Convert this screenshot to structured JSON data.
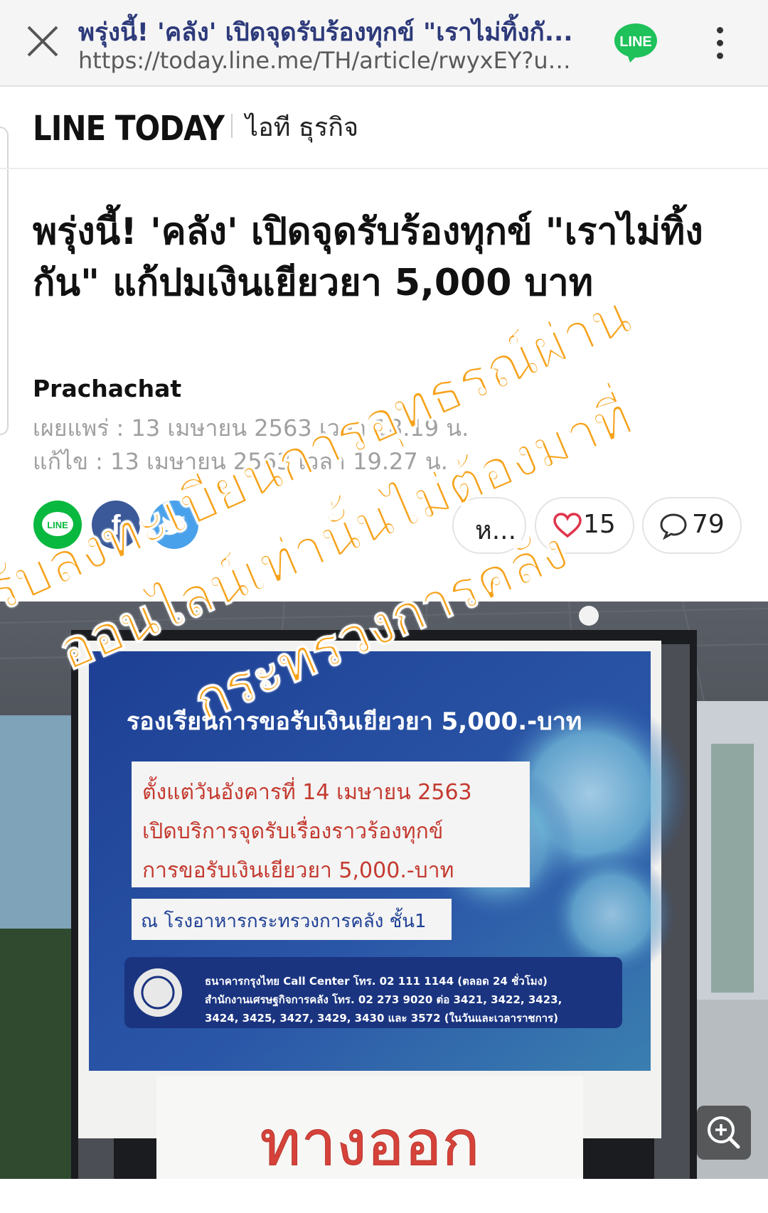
{
  "browser": {
    "page_title": "พรุ่งนี้! 'คลัง' เปิดจุดรับร้องทุกข์ \"เราไม่ทิ้งกั...",
    "url": "https://today.line.me/TH/article/rwyxEY?ut...",
    "close_icon": "close-icon",
    "app_badge": "LINE",
    "menu_icon": "more-vert-icon"
  },
  "header": {
    "brand": "LINE TODAY",
    "section": "ไอที ธุรกิจ"
  },
  "article": {
    "headline": "พรุ่งนี้! 'คลัง' เปิดจุดรับร้องทุกข์ \"เราไม่ทิ้งกัน\" แก้ปมเงินเยียวยา 5,000 บาท",
    "source": "Prachachat",
    "published": "เผยแพร่ : 13 เมษายน 2563 เวลา 18.19 น.",
    "edited": "แก้ไข : 13 เมษายน 2563 เวลา 19.27 น."
  },
  "actions": {
    "share_line": "LINE",
    "share_facebook": "f",
    "share_twitter": "twitter-icon",
    "pill_partial": "ห...",
    "likes": "15",
    "comments": "79",
    "like_color": "#e0344a"
  },
  "overlay": {
    "line1": "รับลงทะเบียนการอุทธรณ์ผ่าน",
    "line2": "ออนไลน์เท่านั้นไม่ต้องมาที่",
    "line3": "กระทรวงการคลัง",
    "color": "#f6a21a"
  },
  "photo": {
    "title": "รองเรียนการขอรับเงินเยียวยา 5,000.-บาท",
    "box_line1": "ตั้งแต่วันอังคารที่ 14 เมษายน 2563",
    "box_line2": "เปิดบริการจุดรับเรื่องราวร้องทุกข์",
    "box_line3": "การขอรับเงินเยียวยา 5,000.-บาท",
    "location": "ณ โรงอาหารกระทรวงการคลัง ชั้น1",
    "contact1": "ธนาคารกรุงไทย Call Center โทร. 02 111 1144 (ตลอด 24 ชั่วโมง)",
    "contact2": "สำนักงานเศรษฐกิจการคลัง โทร. 02 273 9020 ต่อ 3421, 3422, 3423,",
    "contact3": "3424, 3425, 3427, 3429, 3430 และ 3572 (ในวันและเวลาราชการ)",
    "exit_sign": "ทางออก",
    "zoom_icon": "zoom-in-icon"
  }
}
